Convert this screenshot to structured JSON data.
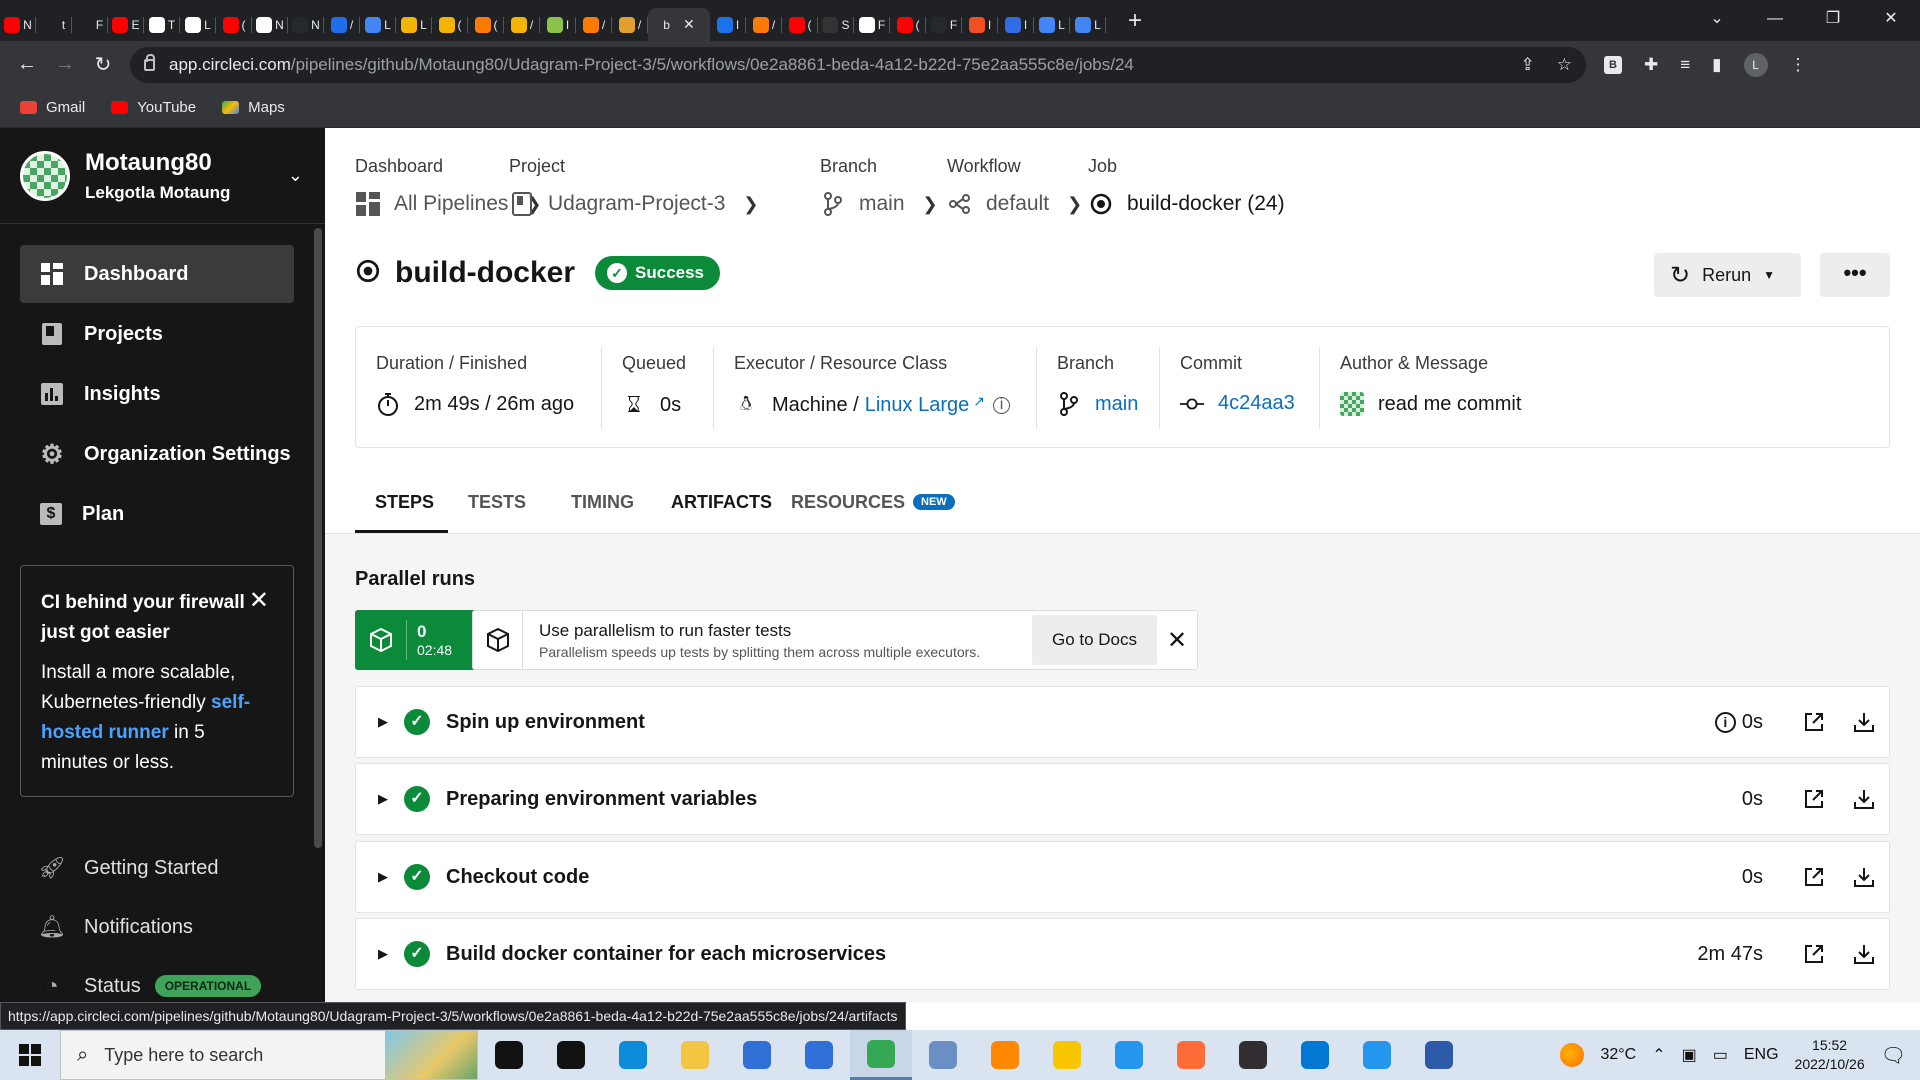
{
  "browser": {
    "tabs": [
      {
        "char": "N",
        "color": "#ff0000"
      },
      {
        "char": "t",
        "color": "#202124"
      },
      {
        "char": "F",
        "color": "#202124"
      },
      {
        "char": "E",
        "color": "#ff0000"
      },
      {
        "char": "T",
        "color": "#ffffff"
      },
      {
        "char": "L",
        "color": "#ffffff"
      },
      {
        "char": "(",
        "color": "#ff0000"
      },
      {
        "char": "N",
        "color": "#ffffff"
      },
      {
        "char": "N",
        "color": "#24292f"
      },
      {
        "char": "/",
        "color": "#1f6feb"
      },
      {
        "char": "L",
        "color": "#4285f4"
      },
      {
        "char": "L",
        "color": "#f4b400"
      },
      {
        "char": "(",
        "color": "#f4b400"
      },
      {
        "char": "(",
        "color": "#ff7a00"
      },
      {
        "char": "/",
        "color": "#f4b400"
      },
      {
        "char": "I",
        "color": "#8bc34a"
      },
      {
        "char": "/",
        "color": "#ff7a00"
      },
      {
        "char": "/",
        "color": "#e0a030"
      }
    ],
    "active_tab": {
      "char": "b",
      "close": "✕"
    },
    "tabs_after": [
      {
        "char": "I",
        "color": "#1a73e8"
      },
      {
        "char": "/",
        "color": "#ff7a00"
      },
      {
        "char": "(",
        "color": "#ff0000"
      },
      {
        "char": "S",
        "color": "#333333"
      },
      {
        "char": "F",
        "color": "#ffffff"
      },
      {
        "char": "(",
        "color": "#ff0000"
      },
      {
        "char": "F",
        "color": "#24292f"
      },
      {
        "char": "I",
        "color": "#f25022"
      },
      {
        "char": "I",
        "color": "#326ce5"
      },
      {
        "char": "L",
        "color": "#4285f4"
      },
      {
        "char": "L",
        "color": "#4285f4"
      }
    ],
    "url_host": "app.circleci.com",
    "url_path": "/pipelines/github/Motaung80/Udagram-Project-3/5/workflows/0e2a8861-beda-4a12-b22d-75e2aa555c8e/jobs/24",
    "profile_initial": "L",
    "ext_badge": "B",
    "bookmarks": [
      {
        "label": "Gmail",
        "color": "#ea4335"
      },
      {
        "label": "YouTube",
        "color": "#ff0000"
      },
      {
        "label": "Maps",
        "color": "#34a853"
      }
    ],
    "status_url": "https://app.circleci.com/pipelines/github/Motaung80/Udagram-Project-3/5/workflows/0e2a8861-beda-4a12-b22d-75e2aa555c8e/jobs/24/artifacts"
  },
  "sidebar": {
    "org_name": "Motaung80",
    "user_name": "Lekgotla Motaung",
    "items": [
      {
        "label": "Dashboard",
        "icon": "dashboard-icon",
        "active": true
      },
      {
        "label": "Projects",
        "icon": "projects-icon"
      },
      {
        "label": "Insights",
        "icon": "insights-icon"
      },
      {
        "label": "Organization Settings",
        "icon": "gear-icon"
      },
      {
        "label": "Plan",
        "icon": "dollar-icon"
      }
    ],
    "promo": {
      "title": "CI behind your firewall just got easier",
      "body_before": "Install a more scalable, Kubernetes-friendly ",
      "link": "self-hosted runner",
      "body_after": " in 5 minutes or less."
    },
    "bottom": [
      {
        "label": "Getting Started",
        "icon": "rocket-icon"
      },
      {
        "label": "Notifications",
        "icon": "bell-icon"
      },
      {
        "label": "Status",
        "icon": "status-icon"
      }
    ],
    "status_badge": "OPERATIONAL"
  },
  "breadcrumbs": [
    {
      "label": "Dashboard",
      "value": "All Pipelines",
      "icon": "pipelines-icon"
    },
    {
      "label": "Project",
      "value": "Udagram-Project-3",
      "icon": "project-icon"
    },
    {
      "label": "Branch",
      "value": "main",
      "icon": "branch-icon"
    },
    {
      "label": "Workflow",
      "value": "default",
      "icon": "workflow-icon"
    },
    {
      "label": "Job",
      "value": "build-docker (24)",
      "icon": "job-icon"
    }
  ],
  "job": {
    "title": "build-docker",
    "status": "Success",
    "rerun_label": "Rerun",
    "more_label": "•••"
  },
  "meta": {
    "duration_label": "Duration / Finished",
    "duration_value": "2m 49s / 26m ago",
    "queued_label": "Queued",
    "queued_value": "0s",
    "executor_label": "Executor / Resource Class",
    "executor_value": "Machine / ",
    "executor_link": "Linux Large",
    "branch_label": "Branch",
    "branch_value": "main",
    "commit_label": "Commit",
    "commit_value": "4c24aa3",
    "author_label": "Author & Message",
    "author_value": "read me commit"
  },
  "tabs": [
    {
      "label": "STEPS",
      "active": true
    },
    {
      "label": "TESTS"
    },
    {
      "label": "TIMING"
    },
    {
      "label": "ARTIFACTS"
    },
    {
      "label": "RESOURCES",
      "badge": "NEW"
    }
  ],
  "parallel": {
    "title": "Parallel runs",
    "run_index": "0",
    "run_time": "02:48",
    "tip_title": "Use parallelism to run faster tests",
    "tip_sub": "Parallelism speeds up tests by splitting them across multiple executors.",
    "docs_button": "Go to Docs"
  },
  "steps": [
    {
      "name": "Spin up environment",
      "duration": "0s",
      "info": true
    },
    {
      "name": "Preparing environment variables",
      "duration": "0s"
    },
    {
      "name": "Checkout code",
      "duration": "0s"
    },
    {
      "name": "Build docker container for each microservices",
      "duration": "2m 47s"
    }
  ],
  "taskbar": {
    "search_placeholder": "Type here to search",
    "apps": [
      {
        "icon": "cortana-icon",
        "color": "#111111"
      },
      {
        "icon": "task-view-icon",
        "color": "#111111"
      },
      {
        "icon": "edge-icon",
        "color": "#0c8bd9"
      },
      {
        "icon": "file-explorer-icon",
        "color": "#f4c542"
      },
      {
        "icon": "store-icon",
        "color": "#2f6fd6"
      },
      {
        "icon": "mail-icon",
        "color": "#2f6fd6"
      },
      {
        "icon": "chrome-icon",
        "color": "#34a853",
        "active": true
      },
      {
        "icon": "network-app-icon",
        "color": "#6a8fc2"
      },
      {
        "icon": "vlc-icon",
        "color": "#ff8800"
      },
      {
        "icon": "triangle-app-icon",
        "color": "#f7c600"
      },
      {
        "icon": "docker-icon",
        "color": "#2496ed"
      },
      {
        "icon": "postman-icon",
        "color": "#ff6c37"
      },
      {
        "icon": "obs-icon",
        "color": "#302e31"
      },
      {
        "icon": "vscode-icon",
        "color": "#0078d4"
      },
      {
        "icon": "docker-desktop-icon",
        "color": "#2496ed"
      },
      {
        "icon": "powershell-icon",
        "color": "#2d5aa8"
      }
    ],
    "temperature": "32°C",
    "language": "ENG",
    "time": "15:52",
    "date": "2022/10/26"
  }
}
